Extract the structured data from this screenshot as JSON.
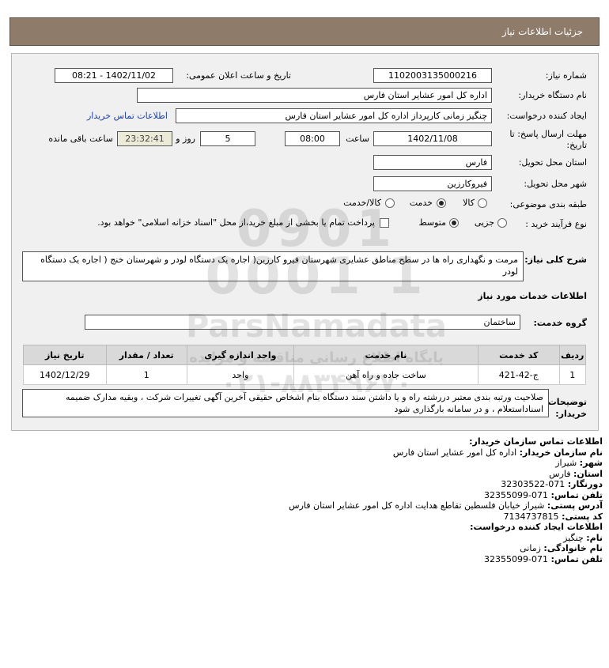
{
  "header": {
    "title": "جزئیات اطلاعات نیاز"
  },
  "fields": {
    "need_number_label": "شماره نیاز:",
    "need_number": "1102003135000216",
    "announce_label": "تاریخ و ساعت اعلان عمومی:",
    "announce_value": "1402/11/02 - 08:21",
    "buyer_org_label": "نام دستگاه خریدار:",
    "buyer_org": "اداره کل امور عشایر استان فارس",
    "creator_label": "ایجاد کننده درخواست:",
    "creator": "چنگیز زمانی کارپرداز اداره کل امور عشایر استان فارس",
    "buyer_contact_link": "اطلاعات تماس خریدار",
    "deadline_label_1": "مهلت ارسال پاسخ: تا",
    "deadline_label_2": "تاریخ:",
    "deadline_date": "1402/11/08",
    "time_label": "ساعت",
    "deadline_time": "08:00",
    "days_value": "5",
    "days_label": "روز و",
    "remaining_time": "23:32:41",
    "remaining_label": "ساعت باقی مانده",
    "province_label": "استان محل تحویل:",
    "province": "فارس",
    "city_label": "شهر محل تحویل:",
    "city": "فیروکارزین",
    "category_label": "طبقه بندی موضوعی:",
    "category_options": [
      "کالا",
      "خدمت",
      "کالا/خدمت"
    ],
    "category_selected": "خدمت",
    "process_label": "نوع فرآیند خرید :",
    "process_options": [
      "جزیی",
      "متوسط"
    ],
    "process_selected": "متوسط",
    "payment_note": "پرداخت تمام یا بخشی از مبلغ خرید،از محل \"اسناد خزانه اسلامی\" خواهد بود."
  },
  "description": {
    "label": "شرح کلی نیاز:",
    "text": "مرمت و نگهداری راه ها در سطح مناطق عشایری شهرستان فیرو کارزین( اجاره یک دستگاه لودر و شهرستان خنج ( اجاره یک دستگاه لودر"
  },
  "services_section": {
    "title": "اطلاعات خدمات مورد نیاز",
    "group_label": "گروه خدمت:",
    "group_value": "ساختمان"
  },
  "table": {
    "headers": [
      "ردیف",
      "کد خدمت",
      "نام خدمت",
      "واحد اندازه گیری",
      "تعداد / مقدار",
      "تاریخ نیاز"
    ],
    "rows": [
      [
        "1",
        "ج-42-421",
        "ساخت جاده و راه آهن",
        "واحد",
        "1",
        "1402/12/29"
      ]
    ]
  },
  "buyer_notes": {
    "label": "توضیحات خریدار:",
    "text": "صلاحیت ورتبه بندی معتبر دررشته راه و یا داشتن سند دستگاه بنام اشخاص حقیقی آخرین آگهی تغییرات شرکت ، وبقیه مدارک ضمیمه اسناداستعلام ، و در سامانه بارگذاری شود"
  },
  "contact": {
    "title": "اطلاعات تماس سازمان خریدار:",
    "org_label": "نام سازمان خریدار:",
    "org": "اداره کل امور عشایر استان فارس",
    "city_label": "شهر:",
    "city": "شیراز",
    "province_label": "استان:",
    "province": "فارس",
    "fax_label": "دورنگار:",
    "fax": "071-32303522",
    "phone_label": "تلفن تماس:",
    "phone": "071-32355099",
    "address_label": "آدرس پستی:",
    "address": "شیراز خیابان فلسطین تقاطع هدایت اداره کل امور عشایر استان فارس",
    "postal_label": "کد پستی:",
    "postal": "7134737815",
    "creator_title": "اطلاعات ایجاد کننده درخواست:",
    "name_label": "نام:",
    "name": "چنگیز",
    "family_label": "نام خانوادگی:",
    "family": "زمانی",
    "creator_phone_label": "تلفن تماس:",
    "creator_phone": "071-32355099"
  },
  "watermark": {
    "brand": "ParsNamadata",
    "line1": "پایگاه اطلاع رسانی مناقصه و مزایده",
    "line2": "۰۲۱-۸۸۳۴۹۶۷۰",
    "number": "0901 0001 1"
  }
}
